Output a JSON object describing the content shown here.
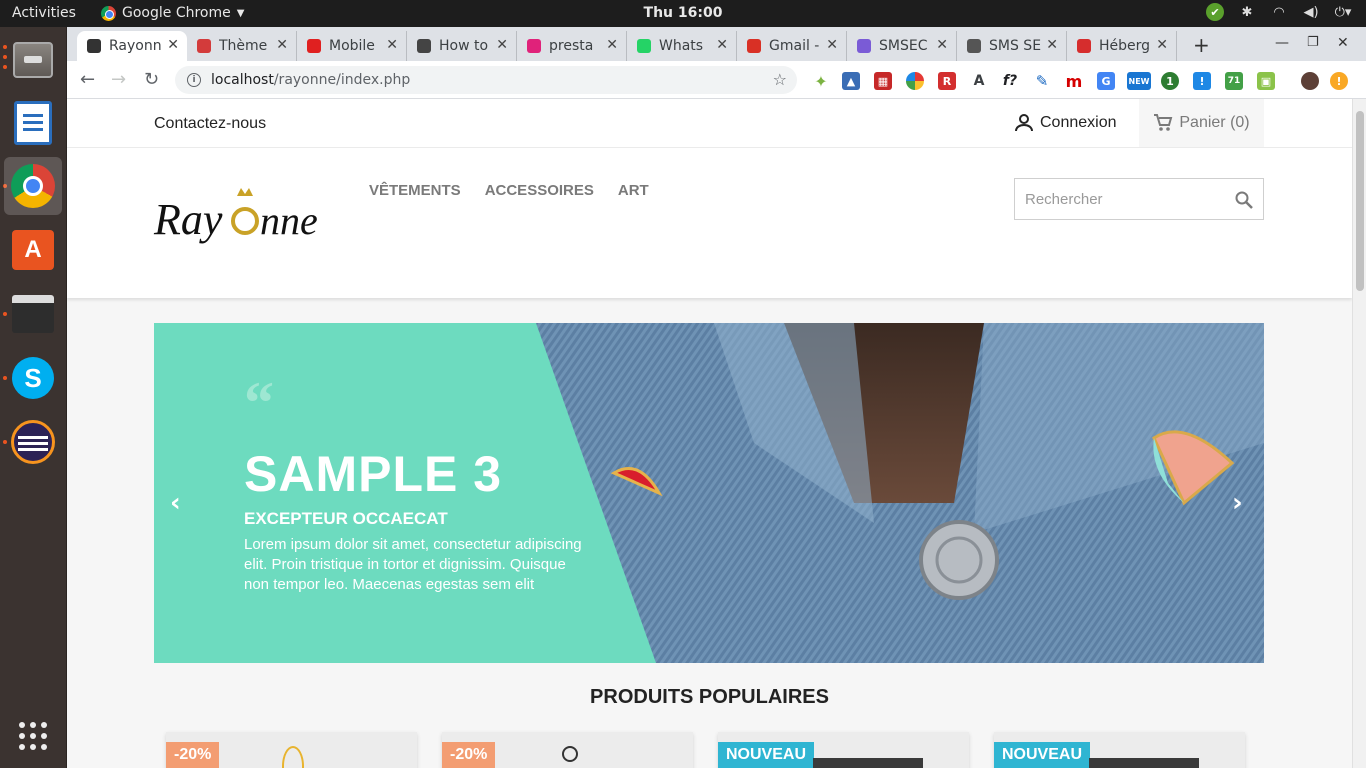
{
  "topbar": {
    "activities": "Activities",
    "app_name": "Google Chrome",
    "clock": "Thu 16:00"
  },
  "dock": {
    "items": [
      "files-icon",
      "writer-icon",
      "chrome-icon",
      "software-center-icon",
      "video-editor-icon",
      "skype-icon",
      "eclipse-icon",
      "show-apps-icon"
    ]
  },
  "browser": {
    "tabs": [
      {
        "label": "Rayonne",
        "favicon_color": "#333333"
      },
      {
        "label": "Thème",
        "favicon_color": "#d33b3b"
      },
      {
        "label": "Mobile",
        "favicon_color": "#e02020"
      },
      {
        "label": "How to",
        "favicon_color": "#444444"
      },
      {
        "label": "presta",
        "favicon_color": "#e0227a"
      },
      {
        "label": "Whats",
        "favicon_color": "#25d366"
      },
      {
        "label": "Gmail -",
        "favicon_color": "#d93025"
      },
      {
        "label": "SMSEC",
        "favicon_color": "#7a5bd6"
      },
      {
        "label": "SMS SE",
        "favicon_color": "#555555"
      },
      {
        "label": "Héberg",
        "favicon_color": "#d62d2d"
      }
    ],
    "new_tab": "+",
    "url_host": "localhost",
    "url_path": "/rayonne/index.php"
  },
  "shop": {
    "contact": "Contactez-nous",
    "signin": "Connexion",
    "cart": "Panier (0)",
    "menu": [
      "VÊTEMENTS",
      "ACCESSOIRES",
      "ART"
    ],
    "search_placeholder": "Rechercher",
    "logo_text": "Rayonne",
    "slide": {
      "quote": "“",
      "title": "SAMPLE 3",
      "subtitle": "EXCEPTEUR OCCAECAT",
      "description": "Lorem ipsum dolor sit amet, consectetur adipiscing elit. Proin tristique in tortor et dignissim. Quisque non tempor leo. Maecenas egestas sem elit"
    },
    "popular_title": "PRODUITS POPULAIRES",
    "products": [
      {
        "flag": "-20%",
        "flag_type": "discount"
      },
      {
        "flag": "-20%",
        "flag_type": "discount"
      },
      {
        "flag": "NOUVEAU",
        "flag_type": "new"
      },
      {
        "flag": "NOUVEAU",
        "flag_type": "new"
      }
    ]
  },
  "colors": {
    "teal": "#6ddbbf",
    "discount_flag": "#f39d72",
    "new_flag": "#2fb5d2",
    "denim": "#6f93b5"
  }
}
